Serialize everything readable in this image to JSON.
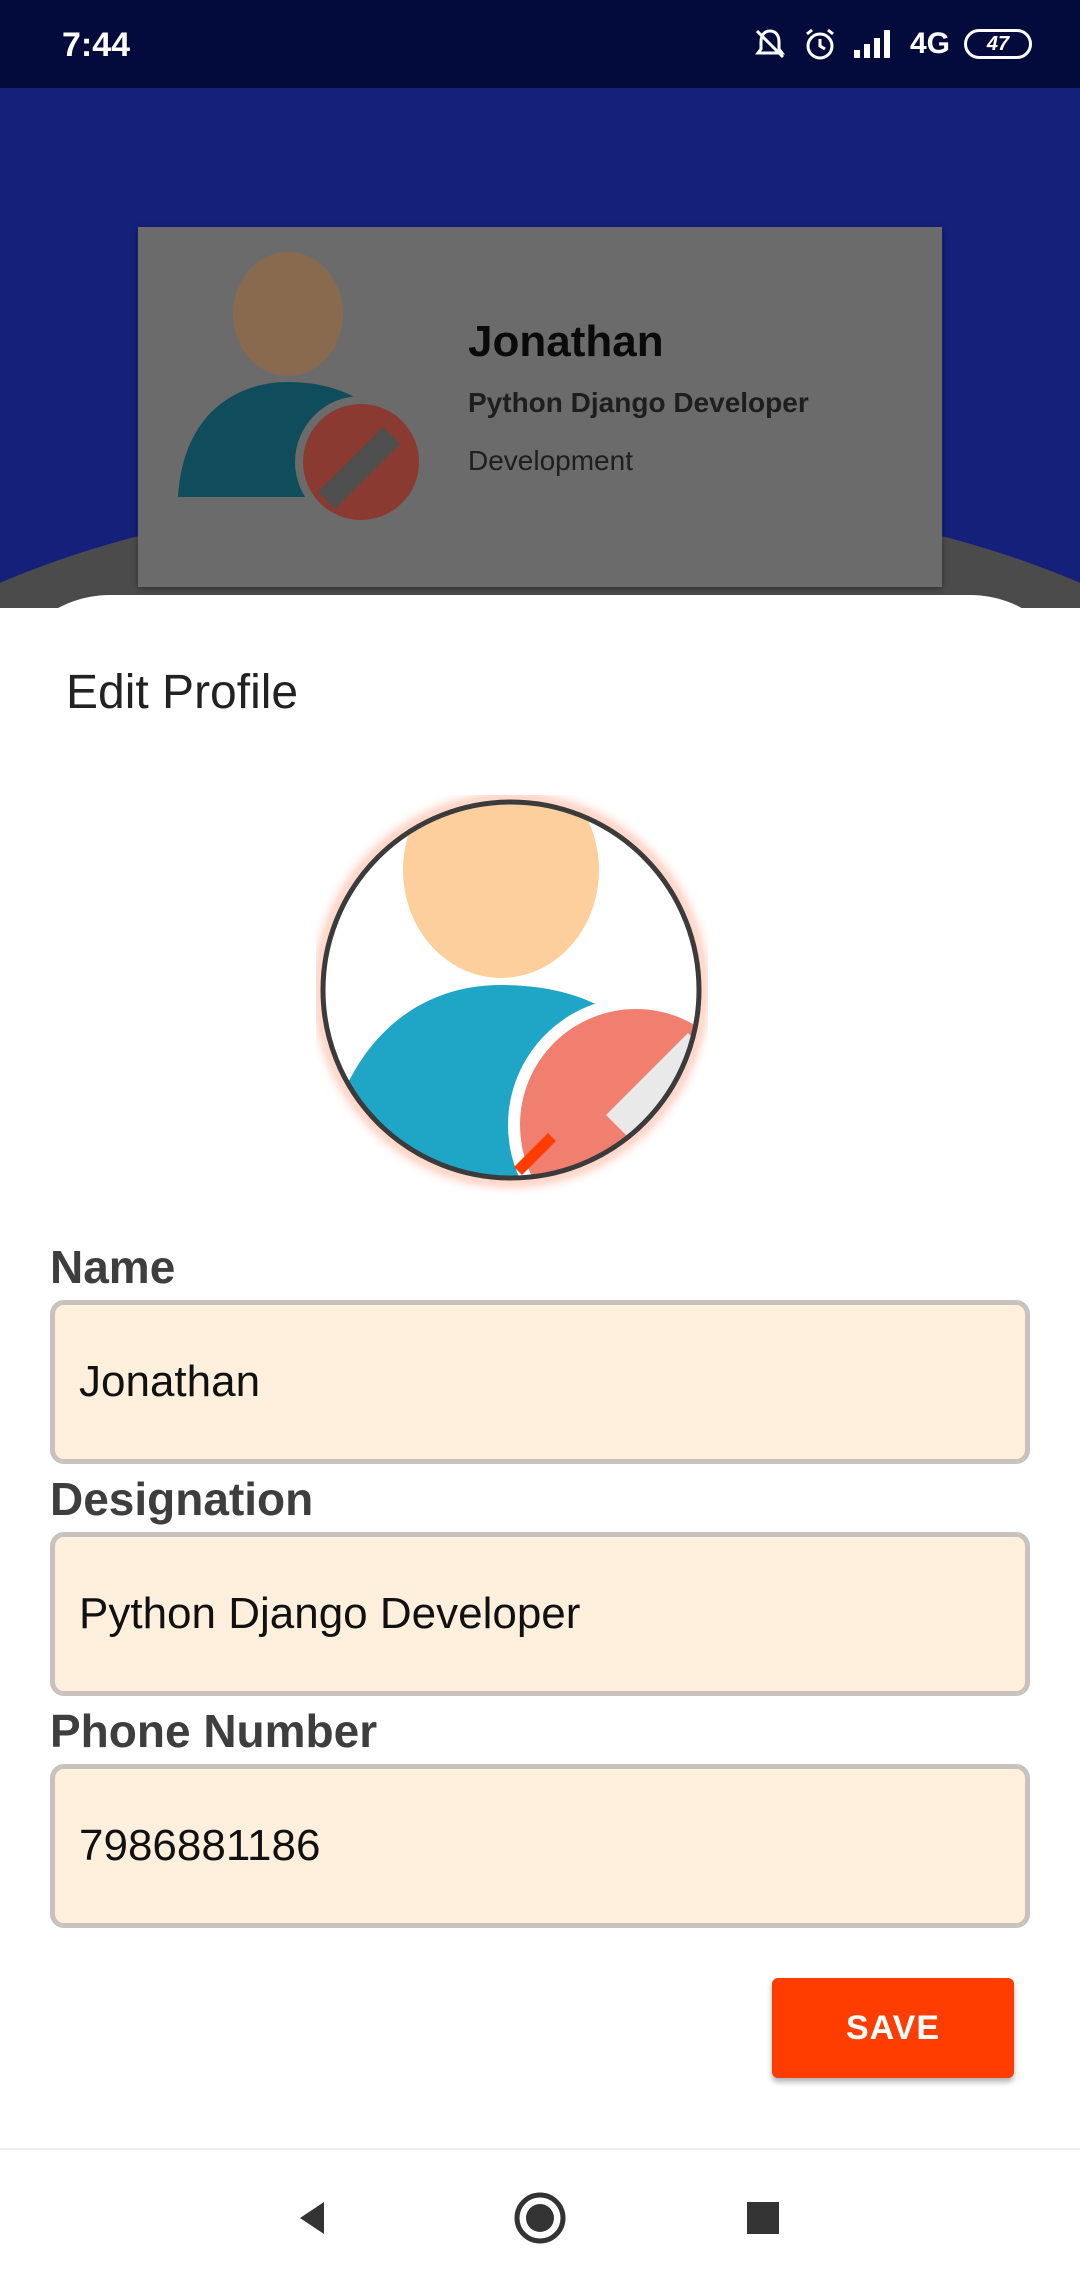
{
  "status_bar": {
    "time": "7:44",
    "network": "4G",
    "battery": "47",
    "icons": [
      "mute-bell-icon",
      "alarm-icon",
      "signal-icon",
      "battery-icon"
    ]
  },
  "profile_card": {
    "name": "Jonathan",
    "designation": "Python Django Developer",
    "department": "Development"
  },
  "sheet": {
    "title": "Edit Profile",
    "fields": {
      "name": {
        "label": "Name",
        "value": "Jonathan"
      },
      "designation": {
        "label": "Designation",
        "value": "Python Django Developer"
      },
      "phone": {
        "label": "Phone Number",
        "value": "7986881186"
      }
    },
    "save_label": "SAVE"
  },
  "nav_bar": {
    "buttons": [
      "back-icon",
      "home-icon",
      "recents-icon"
    ]
  },
  "colors": {
    "header_blue": "#15207a",
    "status_bar": "#030b3d",
    "accent": "#ff3d00",
    "input_bg": "#fff0de"
  }
}
